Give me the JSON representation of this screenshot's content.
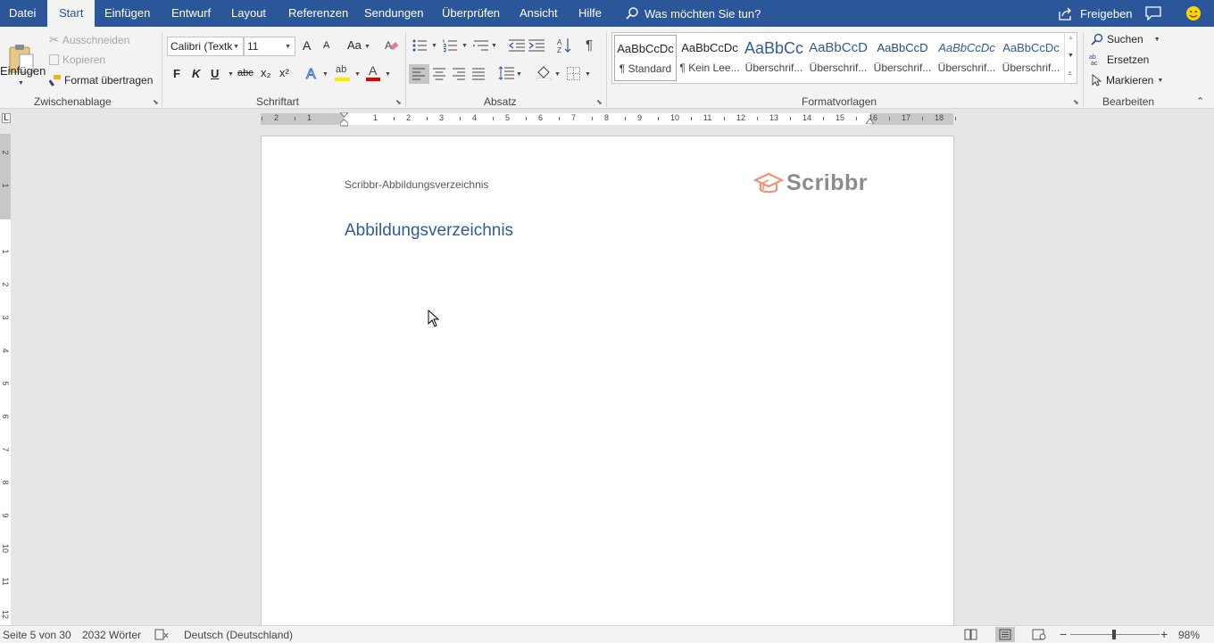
{
  "tabs": [
    "Datei",
    "Start",
    "Einfügen",
    "Entwurf",
    "Layout",
    "Referenzen",
    "Sendungen",
    "Überprüfen",
    "Ansicht",
    "Hilfe"
  ],
  "tell_me": "Was möchten Sie tun?",
  "share": "Freigeben",
  "clipboard": {
    "paste": "Einfügen",
    "cut": "Ausschneiden",
    "copy": "Kopieren",
    "format_painter": "Format übertragen",
    "label": "Zwischenablage"
  },
  "font": {
    "name": "Calibri (Textk",
    "size": "11",
    "bold": "F",
    "italic": "K",
    "underline": "U",
    "strike": "abc",
    "sub": "x₂",
    "sup": "x²",
    "grow": "A",
    "shrink": "A",
    "case": "Aa",
    "label": "Schriftart"
  },
  "paragraph": {
    "label": "Absatz",
    "pilcrow": "¶"
  },
  "styles": {
    "label": "Formatvorlagen",
    "items": [
      {
        "preview": "AaBbCcDc",
        "name": "¶ Standard"
      },
      {
        "preview": "AaBbCcDc",
        "name": "¶ Kein Lee..."
      },
      {
        "preview": "AaBbCc",
        "name": "Überschrif..."
      },
      {
        "preview": "AaBbCcD",
        "name": "Überschrif..."
      },
      {
        "preview": "AaBbCcD",
        "name": "Überschrif..."
      },
      {
        "preview": "AaBbCcDc",
        "name": "Überschrif..."
      },
      {
        "preview": "AaBbCcDc",
        "name": "Überschrif..."
      }
    ]
  },
  "editing": {
    "find": "Suchen",
    "replace": "Ersetzen",
    "select": "Markieren",
    "label": "Bearbeiten"
  },
  "ruler": {
    "numbers": [
      "2",
      "1",
      "1",
      "2",
      "3",
      "4",
      "5",
      "6",
      "7",
      "8",
      "9",
      "10",
      "11",
      "12",
      "13",
      "14",
      "15",
      "16",
      "17",
      "18"
    ]
  },
  "vruler": {
    "numbers": [
      "2",
      "1",
      "1",
      "2",
      "3",
      "4",
      "5",
      "6",
      "7",
      "8",
      "9",
      "10",
      "11",
      "12"
    ]
  },
  "document": {
    "header": "Scribbr-Abbildungsverzeichnis",
    "logo": "Scribbr",
    "title": "Abbildungsverzeichnis"
  },
  "status": {
    "page": "Seite 5 von 30",
    "words": "2032 Wörter",
    "language": "Deutsch (Deutschland)",
    "zoom": "98%",
    "zoom_level": 0.98
  },
  "colors": {
    "accent": "#2b579a",
    "heading": "#2e5c96",
    "logo": "#f09178",
    "highlight": "#ffe600",
    "font_color": "#e00000"
  }
}
